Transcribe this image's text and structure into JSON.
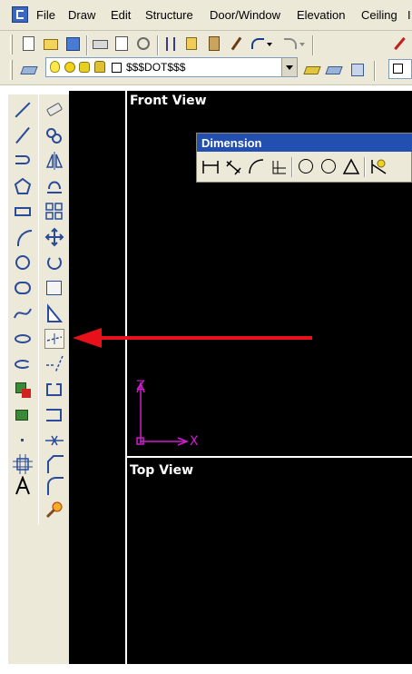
{
  "menu": {
    "items": [
      "File",
      "Draw",
      "Edit",
      "Structure",
      "Door/Window",
      "Elevation",
      "Ceiling",
      "I"
    ]
  },
  "layer_toolbar": {
    "current_layer": "$$$DOT$$$"
  },
  "viewports": {
    "front_label": "Front View",
    "top_label": "Top View"
  },
  "dimension_toolbar": {
    "title": "Dimension"
  },
  "ucs": {
    "z_label": "Z",
    "x_label": "X"
  },
  "annotation": {
    "arrow_color": "#e8111a",
    "points_to": "dimension-tool-button"
  },
  "colors": {
    "canvas_bg": "#000000",
    "ui_bg": "#ece9d8",
    "title_blue": "#2350b0",
    "ucs_magenta": "#d01cd0",
    "viewport_border": "#ffffff"
  },
  "icons": {
    "left_column": [
      "line-icon",
      "polyline-icon",
      "arc-polyline-icon",
      "polygon-icon",
      "rectangle-icon",
      "arc-icon",
      "circle-icon",
      "revision-cloud-icon",
      "spline-icon",
      "ellipse-icon",
      "ellipse-arc-icon",
      "block-insert-icon",
      "make-block-icon",
      "point-icon",
      "hatch-icon",
      "text-icon"
    ],
    "right_column": [
      "eraser-icon",
      "copy-icon",
      "mirror-icon",
      "offset-icon",
      "array-icon",
      "move-icon",
      "rotate-icon",
      "scale-icon",
      "stretch-icon",
      "trim-icon",
      "extend-icon",
      "break-icon",
      "break-at-point-icon",
      "join-icon",
      "chamfer-icon",
      "fillet-icon",
      "explode-icon"
    ]
  }
}
